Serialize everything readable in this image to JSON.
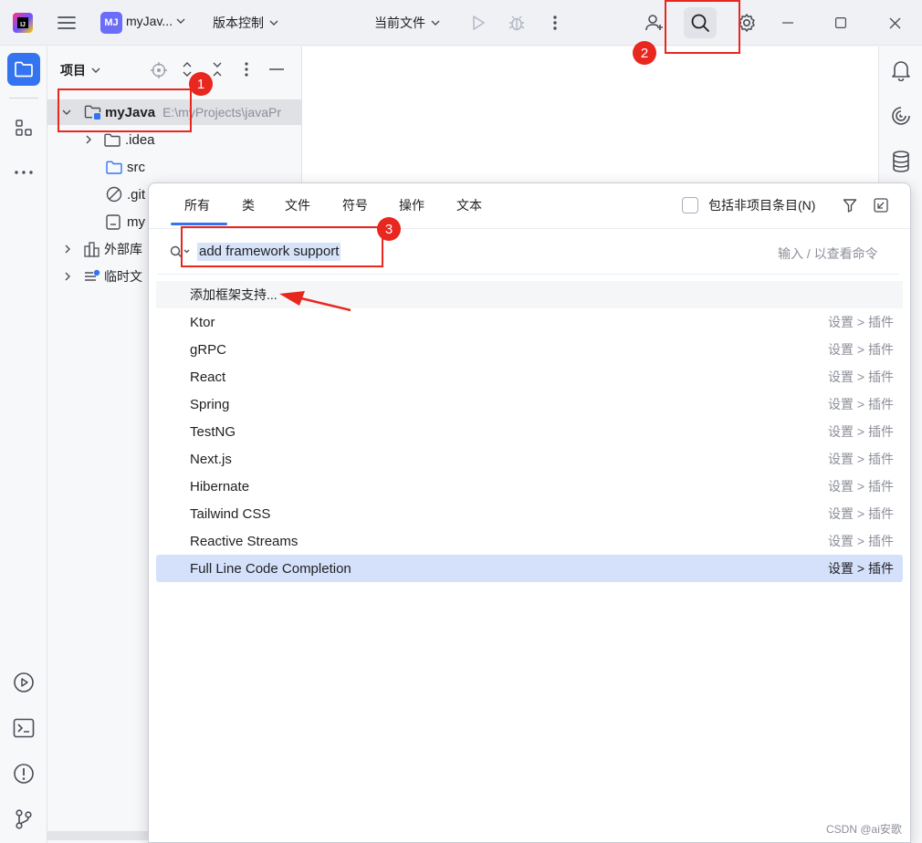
{
  "titlebar": {
    "project_badge": "MJ",
    "project_name": "myJav...",
    "vcs_label": "版本控制",
    "run_config": "当前文件"
  },
  "icons": {
    "menu": "hamburger-icon",
    "run": "play-icon",
    "debug": "bug-icon",
    "more": "more-vertical-icon",
    "add_user": "add-user-icon",
    "search": "search-icon",
    "settings": "gear-icon"
  },
  "project_panel": {
    "title": "项目",
    "tree": [
      {
        "label": "myJava",
        "path": "E:\\myProjects\\javaPr",
        "expanded": true,
        "bold": true
      },
      {
        "label": ".idea",
        "type": "folder"
      },
      {
        "label": "src",
        "type": "folder"
      },
      {
        "label": ".git",
        "type": "ignored"
      },
      {
        "label": "my",
        "type": "file"
      },
      {
        "label": "外部库",
        "type": "library"
      },
      {
        "label": "临时文",
        "type": "scratch"
      }
    ]
  },
  "search_popup": {
    "tabs": [
      "所有",
      "类",
      "文件",
      "符号",
      "操作",
      "文本"
    ],
    "active_tab": "所有",
    "include_non_project_label": "包括非项目条目(N)",
    "query": "add framework support",
    "hint": "输入 / 以查看命令",
    "results": [
      {
        "label": "添加框架支持...",
        "location": ""
      },
      {
        "label": "Ktor",
        "location": "设置 > 插件"
      },
      {
        "label": "gRPC",
        "location": "设置 > 插件"
      },
      {
        "label": "React",
        "location": "设置 > 插件"
      },
      {
        "label": "Spring",
        "location": "设置 > 插件"
      },
      {
        "label": "TestNG",
        "location": "设置 > 插件"
      },
      {
        "label": "Next.js",
        "location": "设置 > 插件"
      },
      {
        "label": "Hibernate",
        "location": "设置 > 插件"
      },
      {
        "label": "Tailwind CSS",
        "location": "设置 > 插件"
      },
      {
        "label": "Reactive Streams",
        "location": "设置 > 插件"
      },
      {
        "label": "Full Line Code Completion",
        "location": "设置 > 插件"
      }
    ],
    "selected_index": 10
  },
  "annotations": {
    "step1": "1",
    "step2": "2",
    "step3": "3",
    "color": "#e8271f"
  },
  "watermark": "CSDN @ai安歌",
  "colors": {
    "accent": "#3574f0",
    "selection": "#d5e1fb",
    "query_highlight": "#d7e3f8"
  }
}
